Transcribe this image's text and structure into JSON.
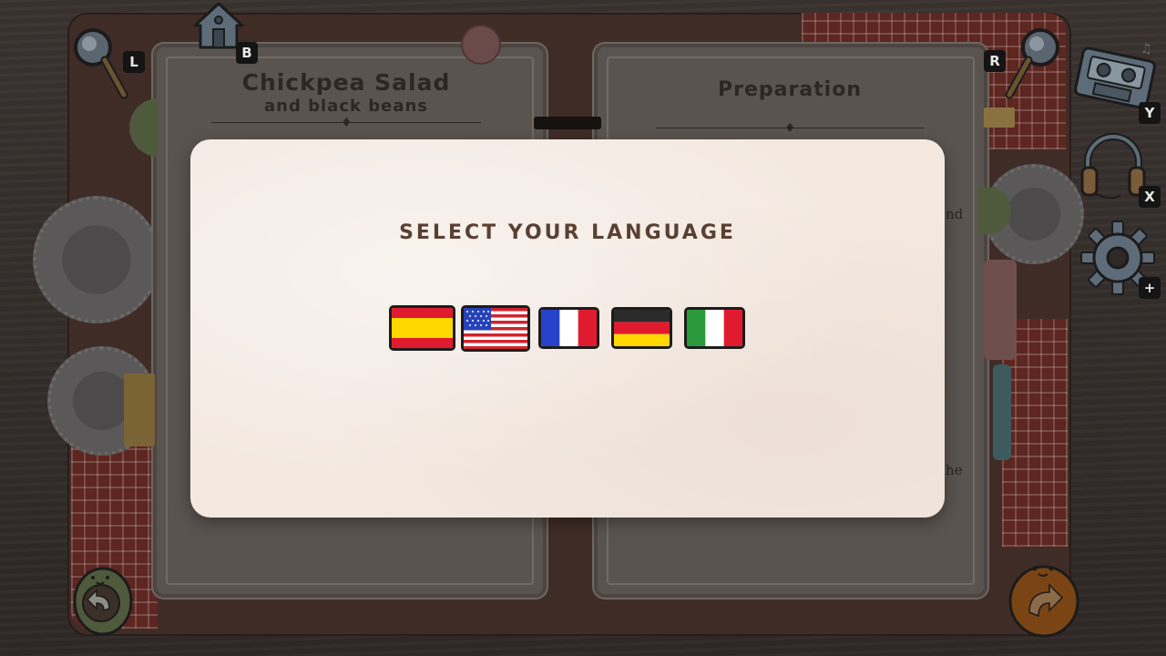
{
  "recipe": {
    "title": "Chickpea Salad",
    "subtitle": "and black beans"
  },
  "preparation": {
    "title": "Preparation",
    "fragment_1": "nd",
    "fragment_2": "he"
  },
  "hud": {
    "key_left": "L",
    "key_home": "B",
    "key_right": "R",
    "key_music": "Y",
    "key_audio": "X",
    "key_settings": "+"
  },
  "modal": {
    "title": "SELECT YOUR LANGUAGE"
  },
  "languages": [
    {
      "code": "es",
      "icon": "spain-flag-icon"
    },
    {
      "code": "en",
      "icon": "usa-flag-icon",
      "selected": true
    },
    {
      "code": "fr",
      "icon": "france-flag-icon"
    },
    {
      "code": "de",
      "icon": "germany-flag-icon"
    },
    {
      "code": "it",
      "icon": "italy-flag-icon"
    }
  ],
  "colors": {
    "modal_bg": "#f3e9e1",
    "title_brown": "#5a4032",
    "wood": "#2f2a27",
    "plaid_red": "#5d2620"
  }
}
